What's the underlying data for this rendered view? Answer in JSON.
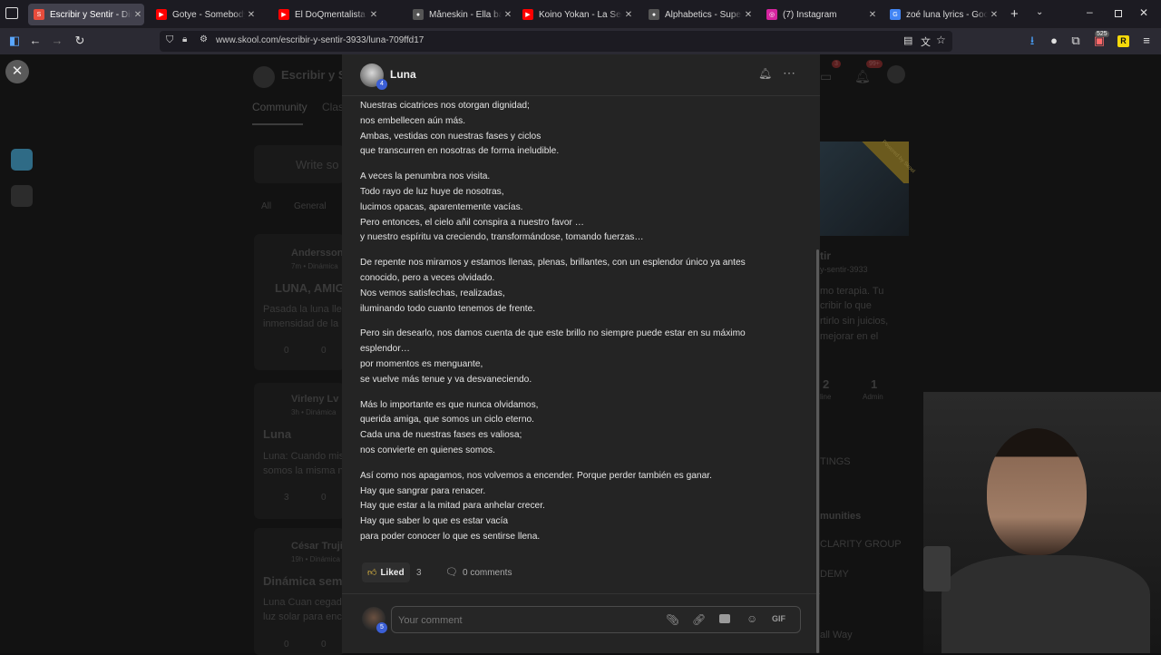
{
  "tabs": [
    {
      "title": "Escribir y Sentir - Dinámica",
      "fav": "S",
      "fav_color": "#e74c3c",
      "active": true
    },
    {
      "title": "Gotye - Somebody That I Used",
      "fav": "▶",
      "fav_color": "#ff0000"
    },
    {
      "title": "El DoQmentalista en vivo de",
      "fav": "▶",
      "fav_color": "#ff0000"
    },
    {
      "title": "Måneskin - Ella baila sola",
      "fav": "●",
      "fav_color": "#555555"
    },
    {
      "title": "Koino Yokan - La Sed (Versión",
      "fav": "▶",
      "fav_color": "#ff0000"
    },
    {
      "title": "Alphabetics - Supernova",
      "fav": "●",
      "fav_color": "#555555"
    },
    {
      "title": "(7) Instagram",
      "fav": "◎",
      "fav_color": "#d6249f"
    },
    {
      "title": "zoé luna lyrics - Google Search",
      "fav": "G",
      "fav_color": "#4285f4"
    }
  ],
  "url": "www.skool.com/escribir-y-sentir-3933/luna-709ffd17",
  "badge_count": "525",
  "background": {
    "group_name": "Escribir y Se",
    "tab_community": "Community",
    "tab_classroom": "Clas",
    "write_placeholder": "Write so",
    "filter_all": "All",
    "filter_general": "General",
    "post1_author": "Andersson",
    "post1_meta": "7m • Dinámica",
    "post1_title": "LUNA, AMIG",
    "post1_body1": "Pasada la luna llen",
    "post1_body2": "inmensidad de la n",
    "post1_likes": "0",
    "post1_comments": "0",
    "post2_author": "Virleny Lv",
    "post2_meta": "3h • Dinámica",
    "post2_title": "Luna",
    "post2_body1": "Luna: Cuando mis",
    "post2_body2": "somos la misma n",
    "post2_likes": "3",
    "post2_comments": "0",
    "post3_author": "César Trujil",
    "post3_meta": "19h • Dinámica",
    "post3_title": "Dinámica sema",
    "post3_body1": "Luna Cuan cegado",
    "post3_body2": "luz solar para enco",
    "post3_likes": "0",
    "post3_comments": "0",
    "right_title": "tir",
    "right_slug": "y-sentir-3933",
    "right_desc1": "mo terapia. Tu",
    "right_desc2": "cribir lo que",
    "right_desc3": "rtirlo sin juicios,",
    "right_desc4": "mejorar en el",
    "stat_num1": "2",
    "stat_lbl1": "line",
    "stat_num2": "1",
    "stat_lbl2": "Admin",
    "settings": "TINGS",
    "communities": "munities",
    "comm1": "CLARITY GROUP",
    "comm2": "DEMY",
    "comm3": "all Way",
    "notif1": "3",
    "notif2": "99+",
    "ribbon": "Powered by Skool"
  },
  "modal": {
    "author": "Luna",
    "author_level": "4",
    "paragraphs": [
      [
        "Nuestras cicatrices nos otorgan dignidad;",
        "nos embellecen aún más.",
        "Ambas, vestidas con nuestras fases y ciclos",
        "que transcurren en nosotras de forma ineludible."
      ],
      [
        "A veces la penumbra nos visita.",
        "Todo rayo de luz huye de nosotras,",
        "lucimos opacas, aparentemente vacías.",
        "Pero entonces, el cielo añil conspira a nuestro favor …",
        "y nuestro espíritu va creciendo, transformándose, tomando fuerzas…"
      ],
      [
        "De repente nos miramos y estamos llenas, plenas, brillantes, con un esplendor único ya antes",
        "conocido, pero a veces olvidado.",
        "Nos vemos satisfechas, realizadas,",
        "iluminando todo cuanto tenemos de frente."
      ],
      [
        "Pero sin desearlo, nos damos cuenta de que este brillo no siempre puede estar en su máximo",
        "esplendor…",
        "por momentos es menguante,",
        "se vuelve más tenue y va desvaneciendo."
      ],
      [
        "Más lo importante es que nunca olvidamos,",
        "querida amiga, que somos un ciclo eterno.",
        "Cada una de nuestras fases es valiosa;",
        "nos convierte en quienes somos."
      ],
      [
        "Así como nos apagamos, nos volvemos a encender. Porque perder también es ganar.",
        "Hay que sangrar para renacer.",
        "Hay que estar a la mitad para anhelar crecer.",
        "Hay que saber lo que es estar vacía",
        "para poder conocer lo que es sentirse llena."
      ]
    ],
    "liked_label": "Liked",
    "like_count": "3",
    "comments_label": "0 comments",
    "comment_placeholder": "Your comment",
    "commenter_level": "5",
    "gif_label": "GIF"
  }
}
